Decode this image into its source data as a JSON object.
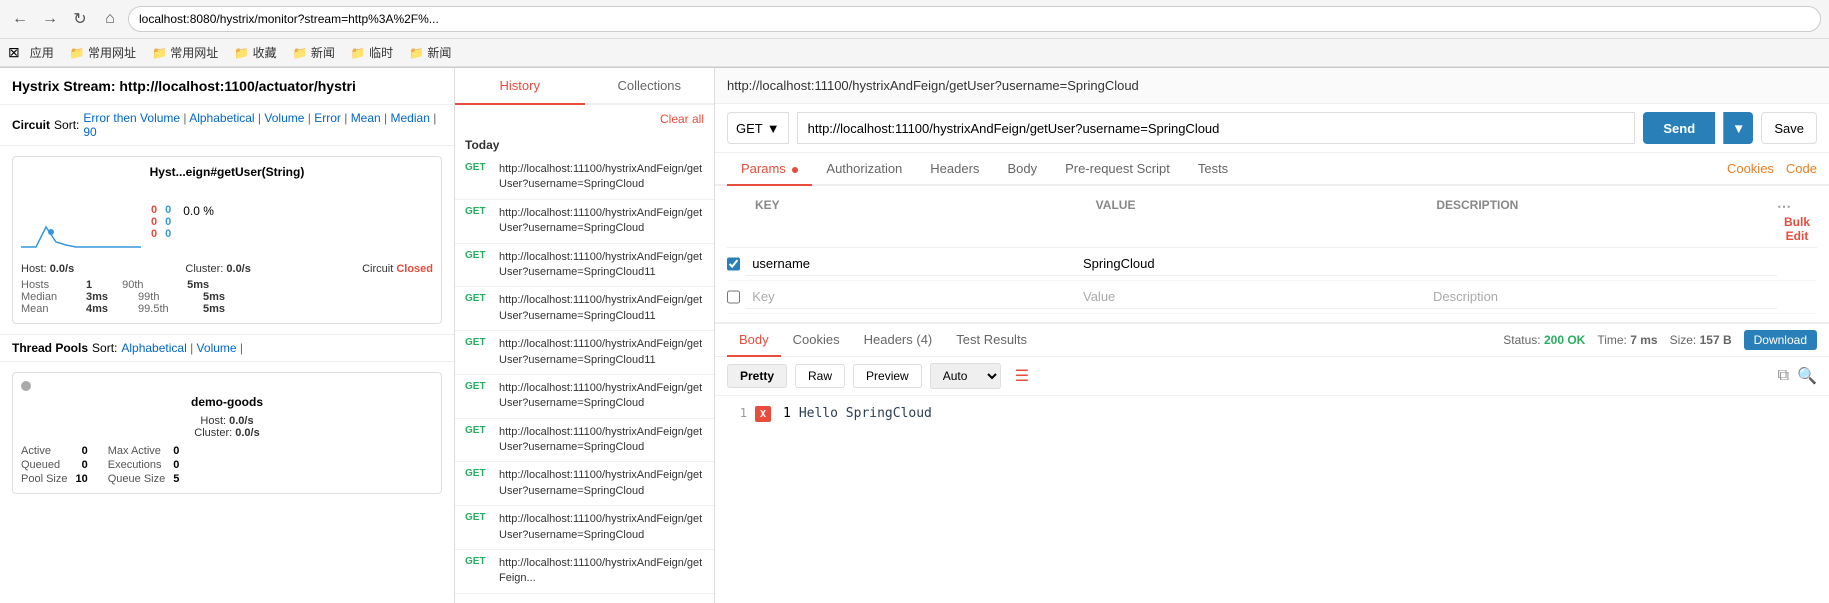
{
  "browser": {
    "url": "localhost:8080/hystrix/monitor?stream=http%3A%2F%...",
    "bookmarks": [
      {
        "label": "应用",
        "icon": "grid"
      },
      {
        "label": "常用网址",
        "icon": "folder"
      },
      {
        "label": "常用网址",
        "icon": "folder"
      },
      {
        "label": "收藏",
        "icon": "folder"
      },
      {
        "label": "新闻",
        "icon": "folder"
      },
      {
        "label": "临时",
        "icon": "folder"
      },
      {
        "label": "新闻",
        "icon": "folder"
      }
    ]
  },
  "request_url_display": "http://localhost:11100/hystrixAndFeign/getUser?username=SpringCloud",
  "hystrix": {
    "title": "Hystrix Stream: http://localhost:1100/actuator/hystri",
    "circuit_label": "Circuit",
    "sort_label": "Sort:",
    "sort_options": [
      "Error then Volume",
      "Alphabetical",
      "Volume",
      "Error",
      "Mean",
      "Median",
      "90"
    ],
    "circuit_card": {
      "title": "Hyst...eign#getUser(String)",
      "stats_red": [
        "0",
        "0",
        "0"
      ],
      "stats_blue": [
        "0",
        "0",
        "0"
      ],
      "percent": "0.0 %",
      "host": "0.0/s",
      "cluster": "0.0/s",
      "status": "Closed",
      "percentiles": [
        {
          "label": "Hosts",
          "val": "1",
          "p90": "90th",
          "p90val": "5ms"
        },
        {
          "label": "Median",
          "val": "3ms",
          "p99": "99th",
          "p99val": "5ms"
        },
        {
          "label": "Mean",
          "val": "4ms",
          "p995": "99.5th",
          "p995val": "5ms"
        }
      ]
    },
    "thread_pools_label": "Thread Pools",
    "thread_pool_sort": "Sort:",
    "thread_pool_sort_options": [
      "Alphabetical",
      "Volume"
    ],
    "thread_pool_card": {
      "title": "demo-goods",
      "host": "0.0/s",
      "cluster": "0.0/s",
      "stats": [
        {
          "label": "Active",
          "val": "0"
        },
        {
          "label": "Max Active",
          "val": "0"
        },
        {
          "label": "Queued",
          "val": "0"
        },
        {
          "label": "Executions",
          "val": "0"
        },
        {
          "label": "Pool Size",
          "val": "10"
        },
        {
          "label": "Queue Size",
          "val": "5"
        }
      ]
    }
  },
  "history": {
    "tab_history": "History",
    "tab_collections": "Collections",
    "clear_all": "Clear all",
    "section_today": "Today",
    "items": [
      {
        "method": "GET",
        "url": "http://localhost:11100/hystrixAndFeign/getUser?username=SpringCloud"
      },
      {
        "method": "GET",
        "url": "http://localhost:11100/hystrixAndFeign/getUser?username=SpringCloud"
      },
      {
        "method": "GET",
        "url": "http://localhost:11100/hystrixAndFeign/getUser?username=SpringCloud11"
      },
      {
        "method": "GET",
        "url": "http://localhost:11100/hystrixAndFeign/getUser?username=SpringCloud11"
      },
      {
        "method": "GET",
        "url": "http://localhost:11100/hystrixAndFeign/getUser?username=SpringCloud11"
      },
      {
        "method": "GET",
        "url": "http://localhost:11100/hystrixAndFeign/getUser?username=SpringCloud"
      },
      {
        "method": "GET",
        "url": "http://localhost:11100/hystrixAndFeign/getUser?username=SpringCloud"
      },
      {
        "method": "GET",
        "url": "http://localhost:11100/hystrixAndFeign/getUser?username=SpringCloud"
      },
      {
        "method": "GET",
        "url": "http://localhost:11100/hystrixAndFeign/getUser?username=SpringCloud"
      },
      {
        "method": "GET",
        "url": "http://localhost:11100/hystrixAndFeign/getFeign..."
      }
    ]
  },
  "request": {
    "method": "GET",
    "url": "http://localhost:11100/hystrixAndFeign/getUser?username=SpringCloud",
    "send_label": "Send",
    "save_label": "Save",
    "tabs": [
      "Params",
      "Authorization",
      "Headers",
      "Body",
      "Pre-request Script",
      "Tests"
    ],
    "active_tab": "Params",
    "tab_right_cookies": "Cookies",
    "tab_right_code": "Code",
    "params_headers": [
      "KEY",
      "VALUE",
      "DESCRIPTION"
    ],
    "bulk_edit_label": "Bulk Edit",
    "params": [
      {
        "checked": true,
        "key": "username",
        "value": "SpringCloud",
        "description": ""
      },
      {
        "checked": false,
        "key": "Key",
        "value": "Value",
        "description": "Description"
      }
    ]
  },
  "response": {
    "tabs": [
      "Body",
      "Cookies",
      "Headers (4)",
      "Test Results"
    ],
    "active_tab": "Body",
    "status_label": "Status:",
    "status_value": "200 OK",
    "time_label": "Time:",
    "time_value": "7 ms",
    "size_label": "Size:",
    "size_value": "157 B",
    "download_label": "Download",
    "format_buttons": [
      "Pretty",
      "Raw",
      "Preview"
    ],
    "active_format": "Pretty",
    "format_select": "Auto",
    "content_lines": [
      {
        "num": "1",
        "badge": "X",
        "text": "Hello SpringCloud"
      }
    ]
  }
}
